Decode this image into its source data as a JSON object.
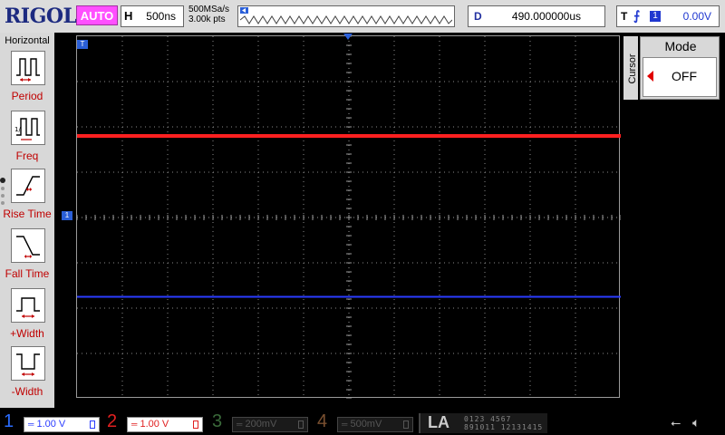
{
  "topbar": {
    "logo": "RIGOL",
    "run_status": "AUTO",
    "horizontal_letter": "H",
    "timebase": "500ns",
    "sample_rate": "500MSa/s",
    "memory_depth": "3.00k pts",
    "delay_letter": "D",
    "delay_value": "490.000000us",
    "trigger_letter": "T",
    "trigger_edge_symbol": "⨍",
    "trigger_source": "1",
    "trigger_level": "0.00V"
  },
  "left_menu": {
    "title": "Horizontal",
    "items": [
      {
        "label": "Period",
        "icon": "period-icon"
      },
      {
        "label": "Freq",
        "icon": "frequency-icon"
      },
      {
        "label": "Rise Time",
        "icon": "rise-time-icon"
      },
      {
        "label": "Fall Time",
        "icon": "fall-time-icon"
      },
      {
        "label": "+Width",
        "icon": "positive-width-icon"
      },
      {
        "label": "-Width",
        "icon": "negative-width-icon"
      }
    ]
  },
  "right_menu": {
    "side_label": "Cursor",
    "mode_title": "Mode",
    "mode_value": "OFF"
  },
  "screen": {
    "channel_marker_label": "1",
    "trigger_marker_label": "T",
    "traces": [
      {
        "channel": "1",
        "color": "#2a3cff",
        "level_divisions": -1.75
      },
      {
        "channel": "2",
        "color": "#ff2020",
        "level_divisions": 1.8
      }
    ]
  },
  "bottombar": {
    "channels": [
      {
        "num": "1",
        "scale": "1.00 V",
        "color": "#2a6cff",
        "on": true
      },
      {
        "num": "2",
        "scale": "1.00 V",
        "color": "#e02020",
        "on": true
      },
      {
        "num": "3",
        "scale": "200mV",
        "color": "#2a8a2a",
        "on": false
      },
      {
        "num": "4",
        "scale": "500mV",
        "color": "#b06020",
        "on": false
      }
    ],
    "la_label": "LA",
    "la_bits_top": "0123 4567",
    "la_bits_bottom": "891011 12131415",
    "usb_icon": "usb-icon",
    "sound_icon": "speaker-muted-icon"
  },
  "colors": {
    "ch1": "#2a3cff",
    "ch2": "#ff2020",
    "accent_run": "#ff50ff",
    "menu_label": "#c00000"
  }
}
